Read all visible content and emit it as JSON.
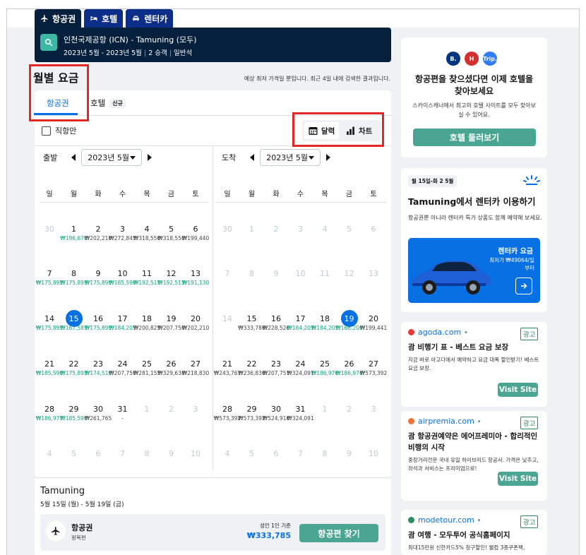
{
  "tabs": [
    {
      "label": "항공권",
      "active": true,
      "icon": "plane-icon"
    },
    {
      "label": "호텔",
      "icon": "bed-icon"
    },
    {
      "label": "렌터카",
      "icon": "car-icon"
    }
  ],
  "search": {
    "route": "인천국제공항 (ICN) - Tamuning (모두)",
    "date_range": "2023년 5월 - 2023년 5월",
    "travelers": "2 승객",
    "cabin": "일반석"
  },
  "section": {
    "title": "월별 요금",
    "note": "예상 최저 가격일 뿐입니다. 최근 4일 내에 검색한 결과입니다."
  },
  "subtabs": {
    "flight": "항공권",
    "hotel": "호텔",
    "hotel_badge": "신규"
  },
  "options": {
    "direct_only": "직항만",
    "view_calendar": "달력",
    "view_chart": "차트"
  },
  "calendar": {
    "weekdays": [
      "일",
      "월",
      "화",
      "수",
      "목",
      "금",
      "토"
    ],
    "depart": {
      "label": "출발",
      "month": "2023년 5월",
      "weeks": [
        [
          {
            "d": "30",
            "m": true
          },
          {
            "d": "1",
            "p": "₩196,670",
            "g": true
          },
          {
            "d": "2",
            "p": "₩202,210"
          },
          {
            "d": "3",
            "p": "₩272,845"
          },
          {
            "d": "4",
            "p": "₩318,550"
          },
          {
            "d": "5",
            "p": "₩318,550"
          },
          {
            "d": "6",
            "p": "₩199,440"
          }
        ],
        [
          {
            "d": "7",
            "p": "₩175,895",
            "g": true
          },
          {
            "d": "8",
            "p": "₩175,895",
            "g": true
          },
          {
            "d": "9",
            "p": "₩175,895",
            "g": true
          },
          {
            "d": "10",
            "p": "₩185,590",
            "g": true
          },
          {
            "d": "11",
            "p": "₩192,515",
            "g": true
          },
          {
            "d": "12",
            "p": "₩192,515",
            "g": true
          },
          {
            "d": "13",
            "p": "₩191,130",
            "g": true
          }
        ],
        [
          {
            "d": "14",
            "p": "₩175,895",
            "g": true
          },
          {
            "d": "15",
            "p": "₩167,585",
            "g": true,
            "s": true
          },
          {
            "d": "16",
            "p": "₩175,895",
            "g": true
          },
          {
            "d": "17",
            "p": "₩184,205",
            "g": true
          },
          {
            "d": "18",
            "p": "₩200,825"
          },
          {
            "d": "19",
            "p": "₩207,750"
          },
          {
            "d": "20",
            "p": "₩202,210"
          }
        ],
        [
          {
            "d": "21",
            "p": "₩185,590",
            "g": true
          },
          {
            "d": "22",
            "p": "₩175,895",
            "g": true
          },
          {
            "d": "23",
            "p": "₩174,510",
            "g": true
          },
          {
            "d": "24",
            "p": "₩207,750"
          },
          {
            "d": "25",
            "p": "₩281,155"
          },
          {
            "d": "26",
            "p": "₩329,630"
          },
          {
            "d": "27",
            "p": "₩218,830"
          }
        ],
        [
          {
            "d": "28",
            "p": "₩186,975",
            "g": true
          },
          {
            "d": "29",
            "p": "₩185,590",
            "g": true
          },
          {
            "d": "30",
            "p": "₩261,765"
          },
          {
            "d": "31",
            "p": "-"
          },
          {
            "d": "1",
            "m": true
          },
          {
            "d": "2",
            "m": true
          },
          {
            "d": "3",
            "m": true
          }
        ],
        [
          {
            "d": "4",
            "m": true
          },
          {
            "d": "5",
            "m": true
          },
          {
            "d": "6",
            "m": true
          },
          {
            "d": "7",
            "m": true
          },
          {
            "d": "8",
            "m": true
          },
          {
            "d": "9",
            "m": true
          },
          {
            "d": "10",
            "m": true
          }
        ]
      ]
    },
    "return": {
      "label": "도착",
      "month": "2023년 5월",
      "weeks": [
        [
          {
            "d": "30",
            "m": true
          },
          {
            "d": "1",
            "m": true
          },
          {
            "d": "2",
            "m": true
          },
          {
            "d": "3",
            "m": true
          },
          {
            "d": "4",
            "m": true
          },
          {
            "d": "5",
            "m": true
          },
          {
            "d": "6",
            "m": true
          }
        ],
        [
          {
            "d": "7",
            "m": true
          },
          {
            "d": "8",
            "m": true
          },
          {
            "d": "9",
            "m": true
          },
          {
            "d": "10",
            "m": true
          },
          {
            "d": "11",
            "m": true
          },
          {
            "d": "12",
            "m": true
          },
          {
            "d": "13",
            "m": true
          }
        ],
        [
          {
            "d": "14",
            "m": true
          },
          {
            "d": "15",
            "p": "₩333,786"
          },
          {
            "d": "16",
            "p": "₩228,526"
          },
          {
            "d": "17",
            "p": "₩184,205",
            "g": true
          },
          {
            "d": "18",
            "p": "₩184,205",
            "g": true
          },
          {
            "d": "19",
            "p": "₩166,200",
            "g": true,
            "s": true
          },
          {
            "d": "20",
            "p": "₩199,441"
          }
        ],
        [
          {
            "d": "21",
            "p": "₩243,761"
          },
          {
            "d": "22",
            "p": "₩236,836"
          },
          {
            "d": "23",
            "p": "₩207,751"
          },
          {
            "d": "24",
            "p": "₩324,091"
          },
          {
            "d": "25",
            "p": "₩186,976",
            "g": true
          },
          {
            "d": "26",
            "p": "₩186,976",
            "g": true
          },
          {
            "d": "27",
            "p": "₩573,392"
          }
        ],
        [
          {
            "d": "28",
            "p": "₩573,392"
          },
          {
            "d": "29",
            "p": "₩573,392"
          },
          {
            "d": "30",
            "p": "₩524,916"
          },
          {
            "d": "31",
            "p": "₩324,091"
          },
          {
            "d": "1",
            "m": true
          },
          {
            "d": "2",
            "m": true
          },
          {
            "d": "3",
            "m": true
          }
        ],
        [
          {
            "d": "4",
            "m": true
          },
          {
            "d": "5",
            "m": true
          },
          {
            "d": "6",
            "m": true
          },
          {
            "d": "7",
            "m": true
          },
          {
            "d": "8",
            "m": true
          },
          {
            "d": "9",
            "m": true
          },
          {
            "d": "10",
            "m": true
          }
        ]
      ]
    }
  },
  "result": {
    "destination": "Tamuning",
    "dates": "5월 15일 (월) - 5월 19일 (금)",
    "type": "항공권",
    "trip": "왕복편",
    "basis": "성인 1인 기준",
    "price": "₩333,785",
    "button": "항공편 찾기"
  },
  "hotel_promo": {
    "logos": [
      {
        "text": "B.",
        "color": "#003580"
      },
      {
        "text": "H",
        "color": "#d32f2f"
      },
      {
        "text": "Trip.",
        "color": "#2f7cf6"
      }
    ],
    "title": "항공편을 찾으셨다면 이제 호텔을 찾아보세요",
    "desc": "스카이스캐너에서 최고의 호텔 사이트를 모두 찾아보실 수 있어요.",
    "button": "호텔 둘러보기"
  },
  "car_promo": {
    "dates": "월 15일-화 2 5월",
    "title": "Tamuning에서 렌터카 이용하기",
    "desc": "항공권뿐 아니라 렌터카 특가 상품도 함께 예약해 보세요.",
    "banner_title": "렌터카 요금",
    "banner_price": "최저가 ₩49064/일부터"
  },
  "ads": [
    {
      "source": "agoda.com",
      "badge": "광고",
      "title": "괌 비행기 표 - 베스트 요금 보장",
      "desc": "지금 바로 아고다에서 예약하고 요금 대폭 할인받기! 베스트 요금 보장.",
      "button": "Visit Site",
      "color": "#e53935"
    },
    {
      "source": "airpremia.com",
      "badge": "광고",
      "title": "괌 항공권예약은 에어프레미아 - 합리적인 비행의 시작",
      "desc": "중장거리전문 국내 유일 하이브리드 항공사. 가격은 낮추고, 좌석과 서비스는 프리미엄으로!",
      "button": "Visit Site",
      "color": "#e8763a"
    },
    {
      "source": "modetour.com",
      "badge": "광고",
      "title": "괌 여행 - 모두투어 공식홈페이지",
      "desc": "최대15만원 신한카드5% 청구할인! 웰컴 3종쿠폰팩,",
      "color": "#2d8b5f"
    }
  ]
}
